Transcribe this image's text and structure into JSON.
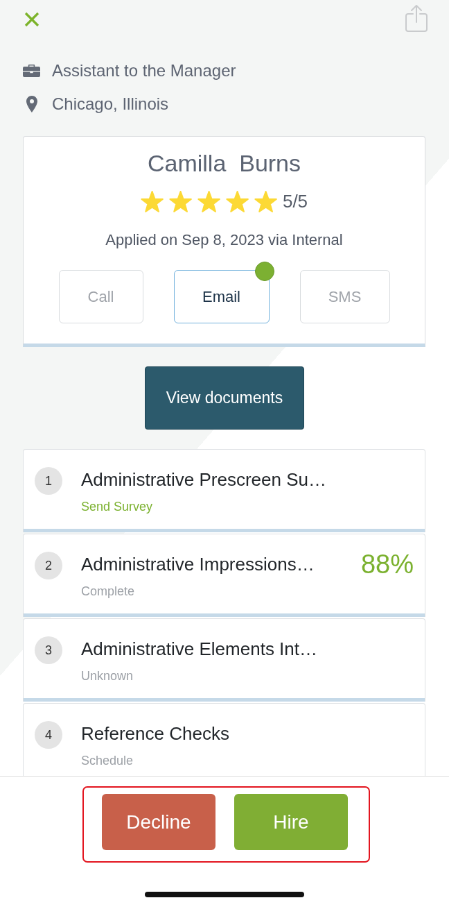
{
  "job": {
    "title": "Assistant to the Manager",
    "location": "Chicago, Illinois"
  },
  "candidate": {
    "name": "Camilla  Burns",
    "stars": 5,
    "rating": "5/5",
    "applied": "Applied on Sep 8, 2023 via Internal",
    "contact_buttons": [
      {
        "label": "Call",
        "disabled": true,
        "unread": false
      },
      {
        "label": "Email",
        "disabled": false,
        "unread": true
      },
      {
        "label": "SMS",
        "disabled": true,
        "unread": false
      }
    ]
  },
  "documents_button": {
    "label": "View documents"
  },
  "steps": [
    {
      "number": "1",
      "title": "Administrative Prescreen Su…",
      "status": "Send Survey",
      "kind": "action"
    },
    {
      "number": "2",
      "title": "Administrative Impressions…",
      "status": "Complete",
      "kind": "status",
      "score": "88%"
    },
    {
      "number": "3",
      "title": "Administrative Elements Int…",
      "status": "Unknown",
      "kind": "status"
    },
    {
      "number": "4",
      "title": "Reference Checks",
      "status": "Schedule",
      "kind": "status"
    }
  ],
  "actions": [
    {
      "label": "Decline",
      "kind": "decline"
    },
    {
      "label": "Hire",
      "kind": "hire"
    }
  ]
}
